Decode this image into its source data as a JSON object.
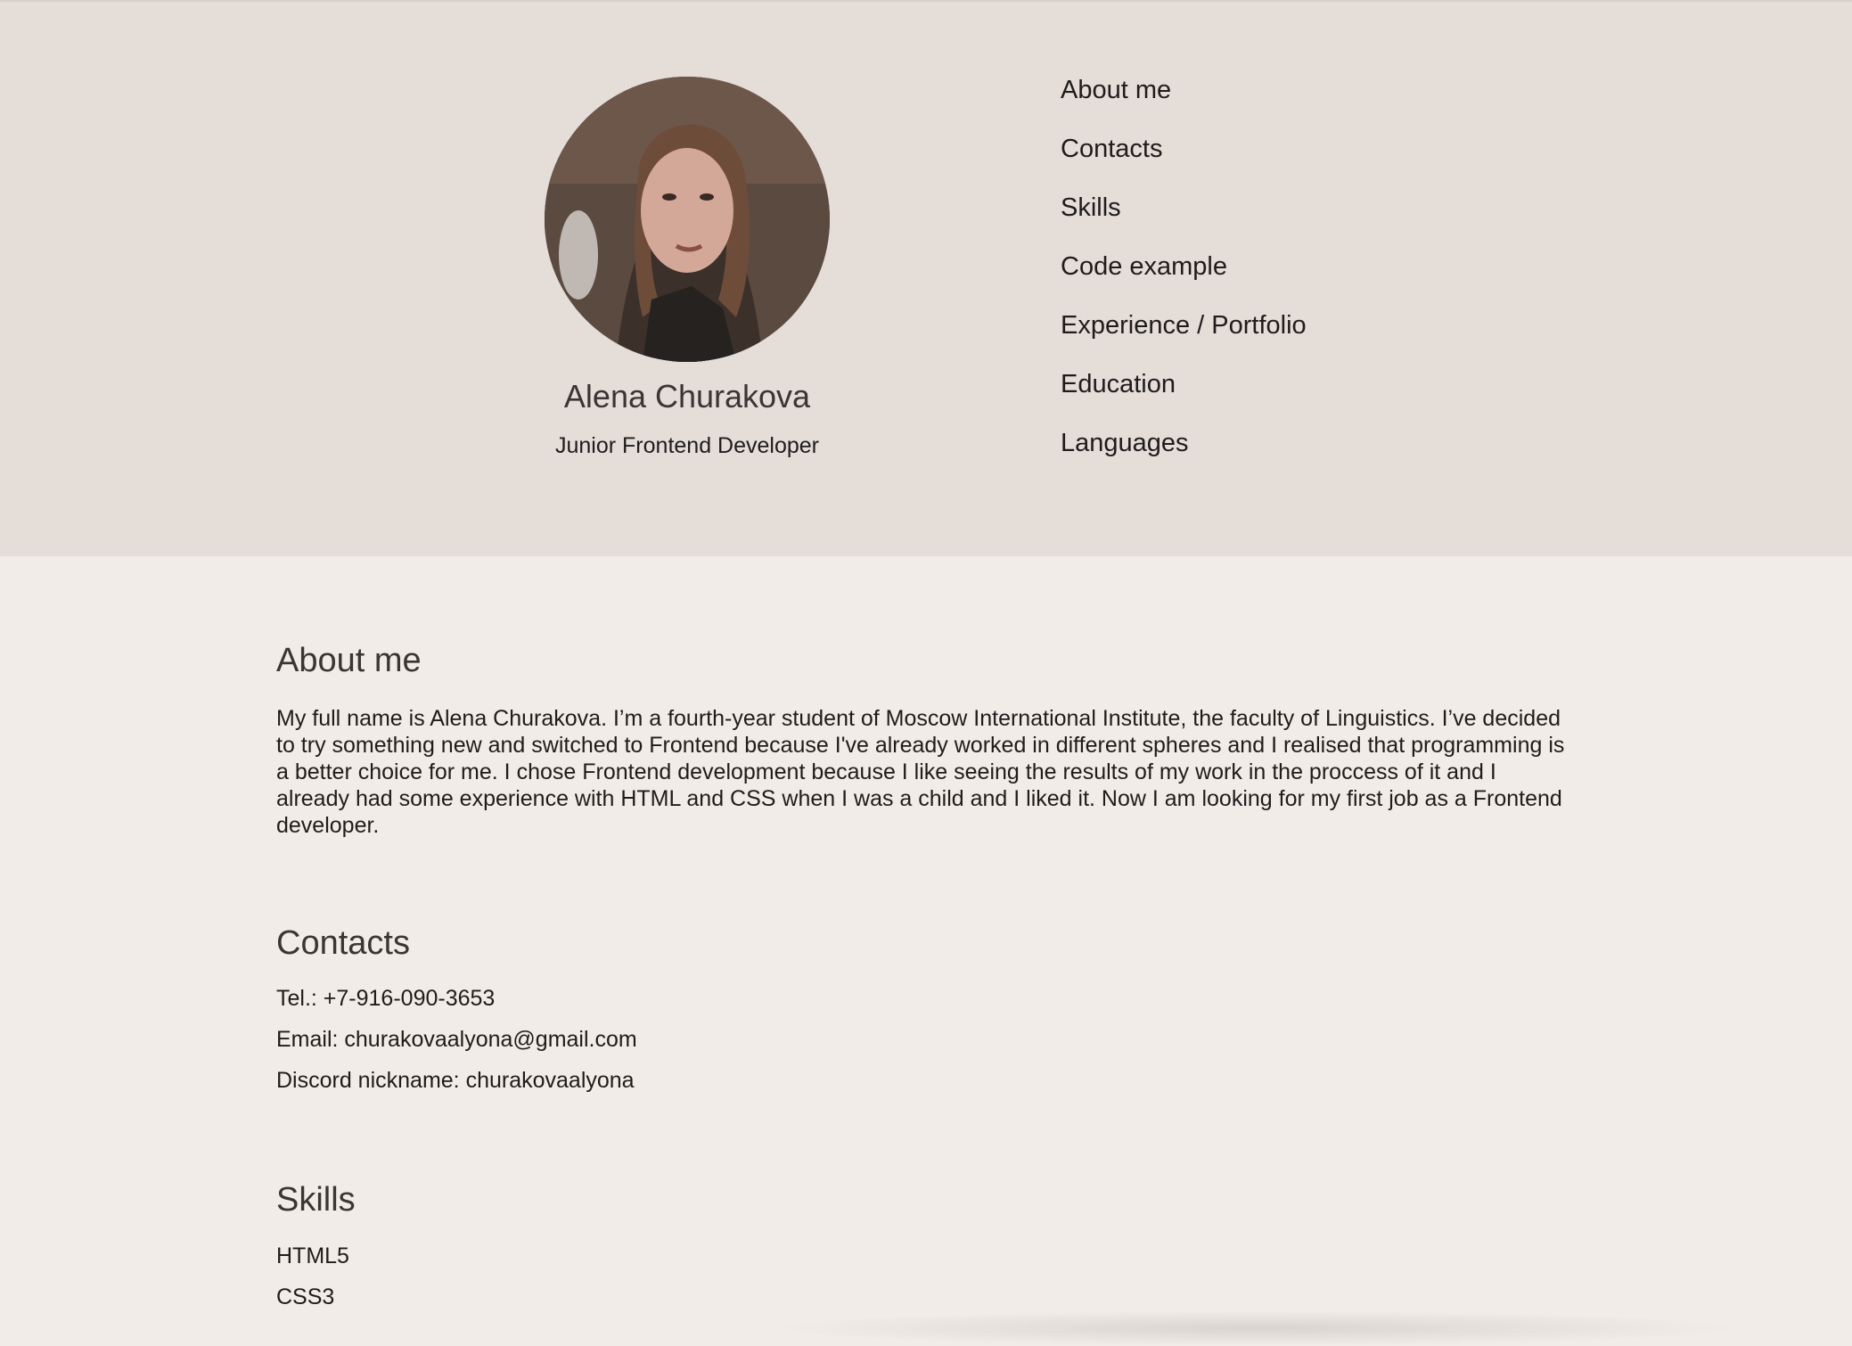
{
  "profile": {
    "name": "Alena Churakova",
    "role": "Junior Frontend Developer"
  },
  "nav": {
    "items": [
      {
        "label": "About me"
      },
      {
        "label": "Contacts"
      },
      {
        "label": "Skills"
      },
      {
        "label": "Code example"
      },
      {
        "label": "Experience / Portfolio"
      },
      {
        "label": "Education"
      },
      {
        "label": "Languages"
      }
    ]
  },
  "about": {
    "title": "About me",
    "text": "My full name is Alena Churakova. I’m a fourth-year student of Moscow International Institute, the faculty of Linguistics. I’ve decided to try something new and switched to Frontend because I've already worked in different spheres and I realised that programming is a better choice for me. I chose Frontend development because I like seeing the results of my work in the proccess of it and I already had some experience with HTML and CSS when I was a child and I liked it. Now I am looking for my first job as a Frontend developer."
  },
  "contacts": {
    "title": "Contacts",
    "tel": "Tel.: +7-916-090-3653",
    "email": "Email: churakovaalyona@gmail.com",
    "discord": "Discord nickname: churakovaalyona"
  },
  "skills": {
    "title": "Skills",
    "items": [
      "HTML5",
      "CSS3"
    ]
  },
  "colors": {
    "header_bg": "#e4ddd8",
    "page_bg": "#f1ece8",
    "heading": "#3b3533",
    "text": "#1f1c1b"
  }
}
